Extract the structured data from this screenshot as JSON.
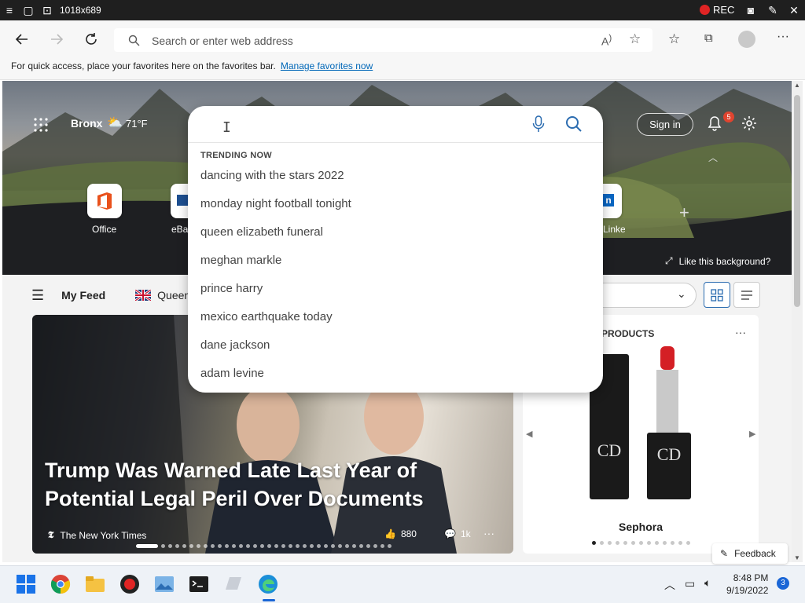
{
  "window": {
    "title": "1018x689",
    "rec_label": "REC"
  },
  "browser": {
    "address_placeholder": "Search or enter web address",
    "favbar_text": "For quick access, place your favorites here on the favorites bar.",
    "favbar_link": "Manage favorites now"
  },
  "newtab": {
    "location": "Bronx",
    "temperature": "71°F",
    "signin_label": "Sign in",
    "notification_count": "5",
    "tiles": [
      {
        "label": "Office"
      },
      {
        "label": "eBay"
      },
      {
        "label": "LinkedIn"
      }
    ],
    "like_background": "Like this background?"
  },
  "search_popup": {
    "trending_label": "TRENDING NOW",
    "suggestions": [
      "dancing with the stars 2022",
      "monday night football tonight",
      "queen elizabeth funeral",
      "meghan markle",
      "prince harry",
      "mexico earthquake today",
      "dane jackson",
      "adam levine"
    ]
  },
  "feed": {
    "my_feed_label": "My Feed",
    "queen_tab_label": "Queen",
    "main_card": {
      "headline": "Trump Was Warned Late Last Year of Potential Legal Peril Over Documents",
      "source": "The New York Times",
      "reactions": "880",
      "comments": "1k"
    },
    "side_card": {
      "header": "PRODUCTS",
      "brand": "Sephora"
    },
    "feedback_label": "Feedback"
  },
  "taskbar": {
    "time": "8:48 PM",
    "date": "9/19/2022",
    "notification_count": "3"
  },
  "colors": {
    "accent": "#0067b8",
    "taskbar_bg": "#eef2f7",
    "rec_red": "#e02424",
    "badge": "#e0442f"
  }
}
